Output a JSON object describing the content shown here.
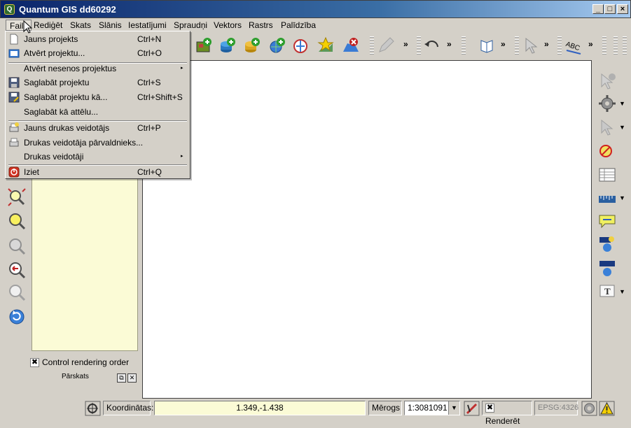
{
  "window": {
    "title": "Quantum GIS dd60292",
    "app_icon_letter": "Q"
  },
  "menu": {
    "items": [
      "Fails",
      "Rediģēt",
      "Skats",
      "Slānis",
      "Iestatījumi",
      "Spraudņi",
      "Vektors",
      "Rastrs",
      "Palīdzība"
    ],
    "active_index": 0
  },
  "file_menu": {
    "items": [
      {
        "label": "Jauns projekts",
        "shortcut": "Ctrl+N",
        "icon": "new-document-icon"
      },
      {
        "label": "Atvērt projektu...",
        "shortcut": "Ctrl+O",
        "icon": "open-project-icon"
      },
      {
        "label": "Atvērt nesenos projektus",
        "shortcut": "",
        "icon": "",
        "submenu": true
      },
      {
        "label": "Saglabāt projektu",
        "shortcut": "Ctrl+S",
        "icon": "save-icon"
      },
      {
        "label": "Saglabāt projektu kā...",
        "shortcut": "Ctrl+Shift+S",
        "icon": "save-as-icon"
      },
      {
        "label": "Saglabāt kā attēlu...",
        "shortcut": "",
        "icon": ""
      },
      {
        "label": "Jauns drukas veidotājs",
        "shortcut": "Ctrl+P",
        "icon": "new-print-composer-icon"
      },
      {
        "label": "Drukas veidotāja pārvaldnieks...",
        "shortcut": "",
        "icon": "printer-icon"
      },
      {
        "label": "Drukas veidotāji",
        "shortcut": "",
        "icon": "",
        "submenu": true
      },
      {
        "label": "Iziet",
        "shortcut": "Ctrl+Q",
        "icon": "exit-icon"
      }
    ],
    "submenu_arrow": "▸"
  },
  "toolbar": {
    "more": "»"
  },
  "legend": {
    "control_rendering_order_label": "Control rendering order",
    "control_rendering_order_checked": "✖"
  },
  "overview": {
    "title": "Pārskats",
    "float_btn": "⧉",
    "close_btn": "✕"
  },
  "status": {
    "coords_label": "Koordinātas:",
    "coords_value": "1.349,-1.438",
    "scale_label": "Mērogs",
    "scale_value": "1:3081091",
    "render_label": "Renderēt",
    "render_checked": "✖",
    "crs": "EPSG:4326",
    "dropdown_arrow": "▼"
  },
  "colors": {
    "title_start": "#0a246a",
    "title_end": "#a6caf0",
    "panel_bg": "#d4d0c8",
    "legend_bg": "#fbfbd6"
  }
}
